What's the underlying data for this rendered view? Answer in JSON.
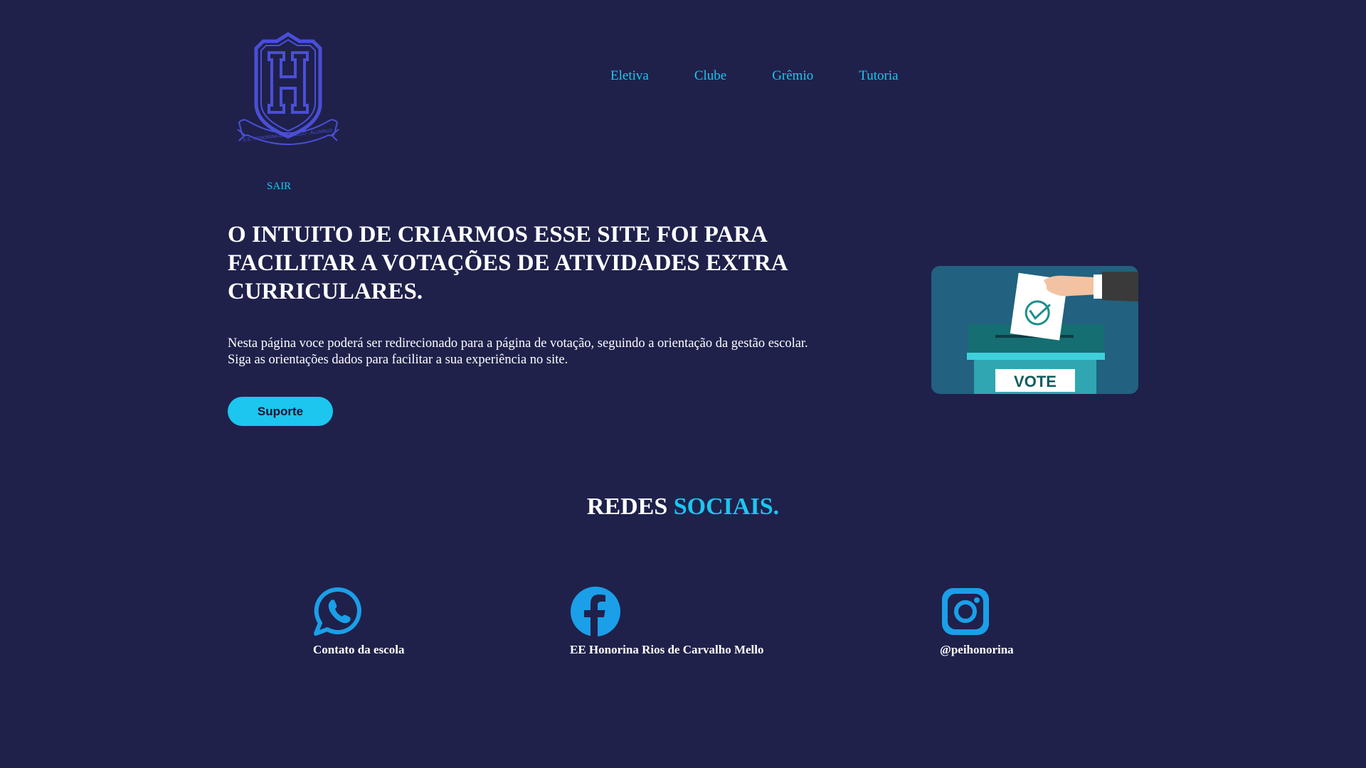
{
  "header": {
    "logo_text": "E.E. HONORINA R. C. MELLO - ALUMNUS",
    "nav": [
      {
        "label": "Eletiva"
      },
      {
        "label": "Clube"
      },
      {
        "label": "Grêmio"
      },
      {
        "label": "Tutoria"
      }
    ],
    "logout_label": "SAIR"
  },
  "hero": {
    "title": "O INTUITO DE CRIARMOS ESSE SITE FOI PARA FACILITAR A VOTAÇÕES DE ATIVIDADES EXTRA CURRICULARES.",
    "text_line1": "Nesta página voce poderá ser redirecionado para a página de votação, seguindo a orientação da gestão escolar.",
    "text_line2": "Siga as orientações dados para facilitar a sua experiência no site.",
    "support_label": "Suporte",
    "image_label": "VOTE"
  },
  "social": {
    "title_part1": "REDES ",
    "title_part2": "SOCIAIS.",
    "items": [
      {
        "icon": "whatsapp-icon",
        "label": "Contato da escola"
      },
      {
        "icon": "facebook-icon",
        "label": "EE Honorina Rios de Carvalho Mello"
      },
      {
        "icon": "instagram-icon",
        "label": "@peihonorina"
      }
    ]
  },
  "colors": {
    "background": "#1f214b",
    "accent": "#1cc6ee",
    "logo": "#4a4fd6",
    "icon_blue": "#1b9fe8"
  }
}
